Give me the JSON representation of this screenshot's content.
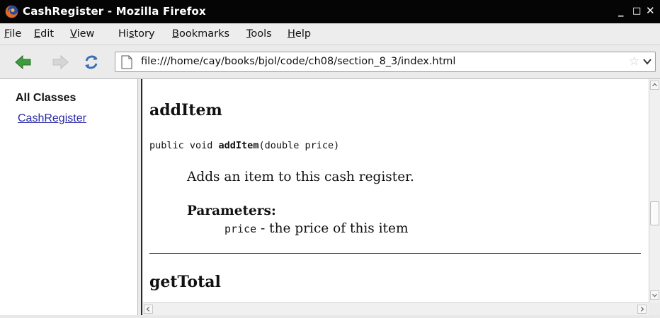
{
  "window": {
    "title": "CashRegister - Mozilla Firefox",
    "controls": [
      "_",
      "□",
      "✕"
    ]
  },
  "menubar": {
    "items": [
      {
        "pre": "",
        "key": "F",
        "post": "ile"
      },
      {
        "pre": "",
        "key": "E",
        "post": "dit"
      },
      {
        "pre": "",
        "key": "V",
        "post": "iew"
      },
      {
        "pre": "Hi",
        "key": "s",
        "post": "tory"
      },
      {
        "pre": "",
        "key": "B",
        "post": "ookmarks"
      },
      {
        "pre": "",
        "key": "T",
        "post": "ools"
      },
      {
        "pre": "",
        "key": "H",
        "post": "elp"
      }
    ]
  },
  "navbar": {
    "url": "file:///home/cay/books/bjol/code/ch08/section_8_3/index.html",
    "icons": [
      "back-arrow-icon",
      "forward-arrow-icon",
      "reload-icon",
      "page-icon",
      "bookmark-star-icon",
      "dropdown-chevron-icon"
    ]
  },
  "left_frame": {
    "heading": "All Classes",
    "link": "CashRegister"
  },
  "main_frame": {
    "method1_title": "addItem",
    "signature": {
      "prefix": "public void ",
      "method": "addItem",
      "suffix": "(double price)"
    },
    "description": "Adds an item to this cash register.",
    "params_label": "Parameters:",
    "param": {
      "name": "price",
      "desc": " - the price of this item"
    },
    "method2_title": "getTotal"
  },
  "colors": {
    "titlebar_bg": "#050505",
    "link": "#2a2aa8",
    "back_arrow": "#3d9c3d"
  }
}
